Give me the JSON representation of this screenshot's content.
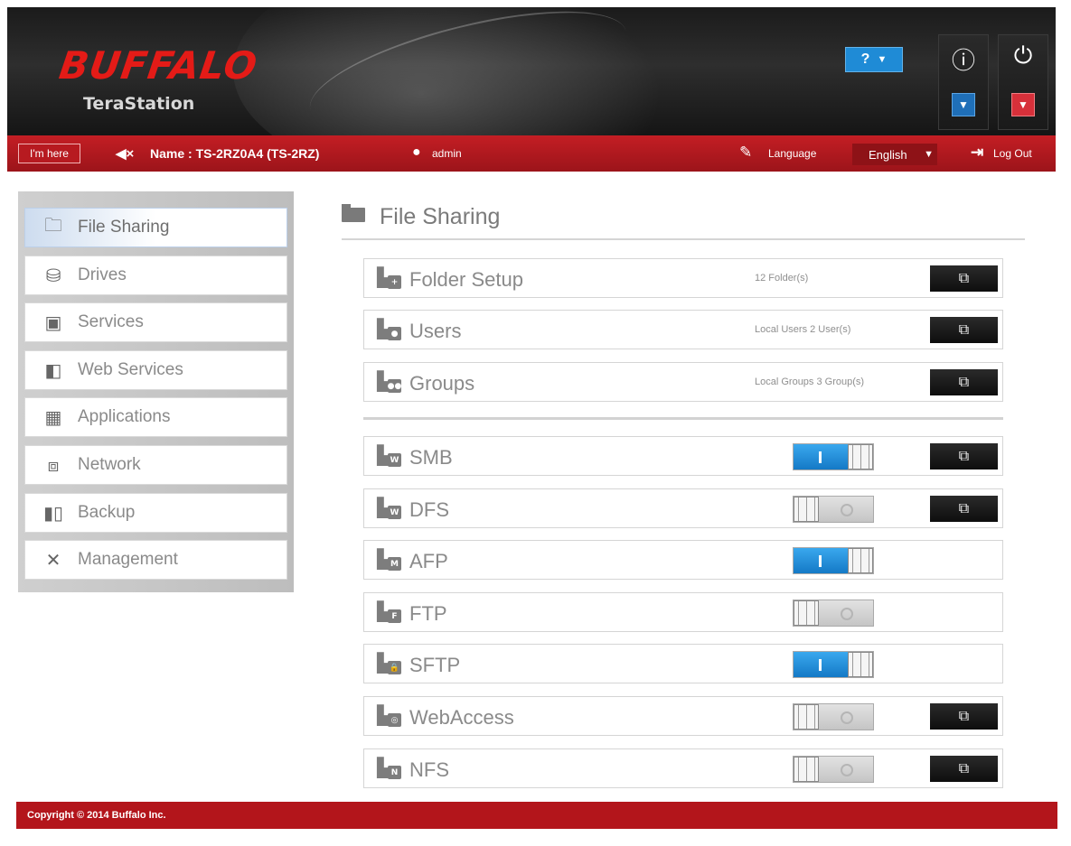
{
  "header": {
    "brand": "BUFFALO",
    "product": "TeraStation",
    "help_label": "?",
    "help_caret": "▼",
    "info_icon": "info-icon",
    "power_icon": "power-icon"
  },
  "infobar": {
    "im_here_label": "I'm here",
    "device_name": "Name : TS-2RZ0A4 (TS-2RZ)",
    "user": "admin",
    "language_label": "Language",
    "language_value": "English",
    "logout_label": "Log Out"
  },
  "sidebar": {
    "items": [
      {
        "label": "File Sharing",
        "icon": "folder-icon",
        "active": true
      },
      {
        "label": "Drives",
        "icon": "drive-icon",
        "active": false
      },
      {
        "label": "Services",
        "icon": "services-icon",
        "active": false
      },
      {
        "label": "Web Services",
        "icon": "web-services-icon",
        "active": false
      },
      {
        "label": "Applications",
        "icon": "applications-icon",
        "active": false
      },
      {
        "label": "Network",
        "icon": "network-icon",
        "active": false
      },
      {
        "label": "Backup",
        "icon": "backup-icon",
        "active": false
      },
      {
        "label": "Management",
        "icon": "management-icon",
        "active": false
      }
    ]
  },
  "main": {
    "title": "File Sharing",
    "setup_rows": [
      {
        "label": "Folder Setup",
        "meta": "12 Folder(s)",
        "icon": "folder-setup-icon"
      },
      {
        "label": "Users",
        "meta": "Local Users 2 User(s)",
        "icon": "users-icon"
      },
      {
        "label": "Groups",
        "meta": "Local Groups 3 Group(s)",
        "icon": "groups-icon"
      }
    ],
    "services": [
      {
        "label": "SMB",
        "badge": "W",
        "enabled": true,
        "has_settings": true
      },
      {
        "label": "DFS",
        "badge": "W",
        "enabled": false,
        "has_settings": true
      },
      {
        "label": "AFP",
        "badge": "M",
        "enabled": true,
        "has_settings": false
      },
      {
        "label": "FTP",
        "badge": "F",
        "enabled": false,
        "has_settings": false
      },
      {
        "label": "SFTP",
        "badge": "🔒",
        "enabled": true,
        "has_settings": false
      },
      {
        "label": "WebAccess",
        "badge": "◎",
        "enabled": false,
        "has_settings": true
      },
      {
        "label": "NFS",
        "badge": "N",
        "enabled": false,
        "has_settings": true
      }
    ],
    "open_button_glyph": "⧉"
  },
  "footer": {
    "copyright": "Copyright © 2014 Buffalo Inc."
  },
  "colors": {
    "brand_red": "#e41b17",
    "bar_red": "#b3151b",
    "toggle_on": "#1e8ddb",
    "toggle_off": "#cfcfcf"
  }
}
